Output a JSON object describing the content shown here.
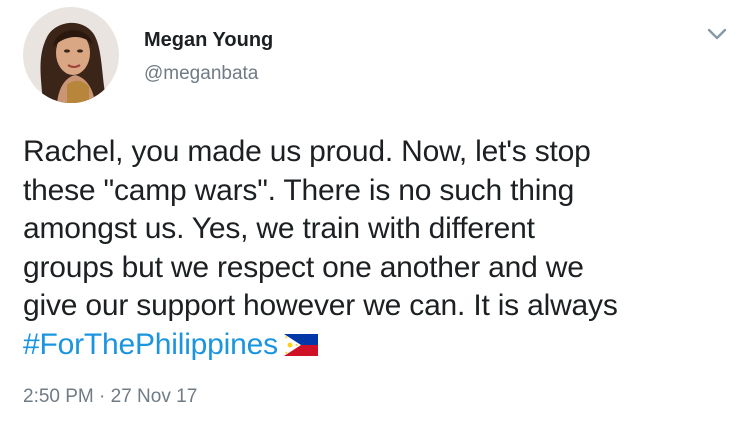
{
  "tweet": {
    "author": {
      "display_name": "Megan Young",
      "handle": "@meganbata"
    },
    "menu_icon": "chevron-down-icon",
    "text_lines": [
      "Rachel, you made us proud. Now, let's stop",
      "these \"camp wars\". There is no such thing",
      "amongst us. Yes, we train with different",
      "groups but we respect one another and we",
      "give our support however we can. It is always"
    ],
    "hashtag": "#ForThePhilippines",
    "emoji": "philippines-flag-icon",
    "timestamp": "2:50 PM · 27 Nov 17"
  },
  "colors": {
    "text": "#1c2022",
    "secondary": "#707b84",
    "link": "#1b95e0"
  }
}
